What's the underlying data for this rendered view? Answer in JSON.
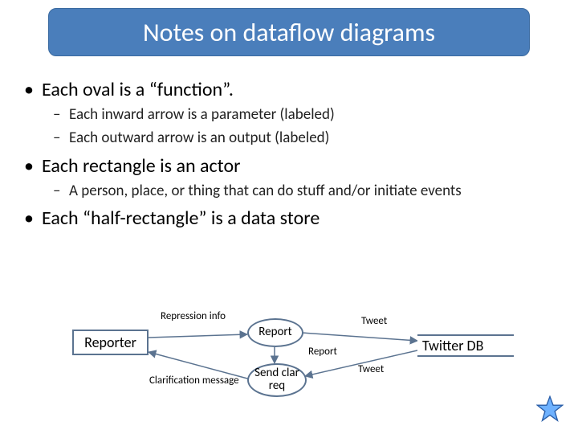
{
  "title": "Notes on dataflow diagrams",
  "bullets": {
    "b1_1": "Each oval is a “function”.",
    "b2_1a": "Each inward arrow is a parameter (labeled)",
    "b2_1b": "Each outward arrow is an output (labeled)",
    "b1_2": "Each rectangle is an actor",
    "b2_2a": "A person, place, or thing that can do stuff and/or initiate events",
    "b1_3": "Each “half-rectangle” is a data store"
  },
  "diagram": {
    "actor": "Reporter",
    "datastore": "Twitter DB",
    "func1": "Report",
    "func2": "Send clar req",
    "edge_repression": "Repression info",
    "edge_clarification": "Clarification message",
    "edge_report": "Report",
    "edge_tweet_top": "Tweet",
    "edge_tweet_bottom": "Tweet"
  },
  "chart_data": {
    "type": "diagram",
    "nodes": [
      {
        "id": "reporter",
        "kind": "actor",
        "label": "Reporter"
      },
      {
        "id": "report_fn",
        "kind": "function",
        "label": "Report"
      },
      {
        "id": "send_clar_req_fn",
        "kind": "function",
        "label": "Send clar req"
      },
      {
        "id": "twitter_db",
        "kind": "datastore",
        "label": "Twitter DB"
      }
    ],
    "edges": [
      {
        "from": "reporter",
        "to": "report_fn",
        "label": "Repression info"
      },
      {
        "from": "send_clar_req_fn",
        "to": "reporter",
        "label": "Clarification message"
      },
      {
        "from": "report_fn",
        "to": "send_clar_req_fn",
        "label": "Report"
      },
      {
        "from": "report_fn",
        "to": "twitter_db",
        "label": "Tweet"
      },
      {
        "from": "twitter_db",
        "to": "send_clar_req_fn",
        "label": "Tweet"
      }
    ]
  }
}
